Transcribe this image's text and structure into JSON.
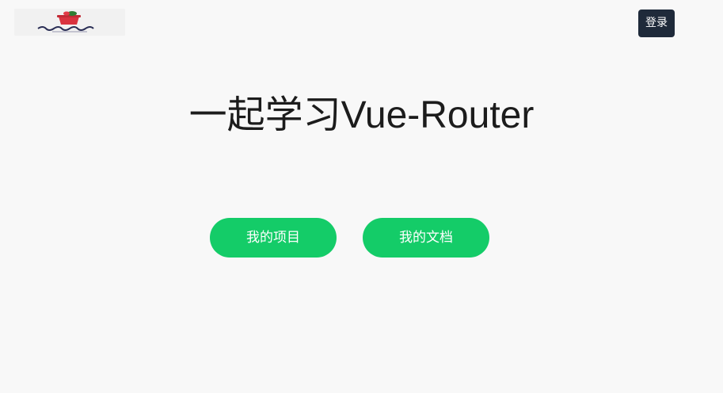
{
  "header": {
    "logo_icon": "basket-logo-icon",
    "login_label": "登录"
  },
  "hero": {
    "title": "一起学习Vue-Router"
  },
  "actions": {
    "projects_label": "我的项目",
    "docs_label": "我的文档"
  },
  "colors": {
    "background": "#f8f8f8",
    "login_button": "#1f2a3a",
    "cta_green": "#14cc68",
    "title_text": "#1c1c1c"
  }
}
